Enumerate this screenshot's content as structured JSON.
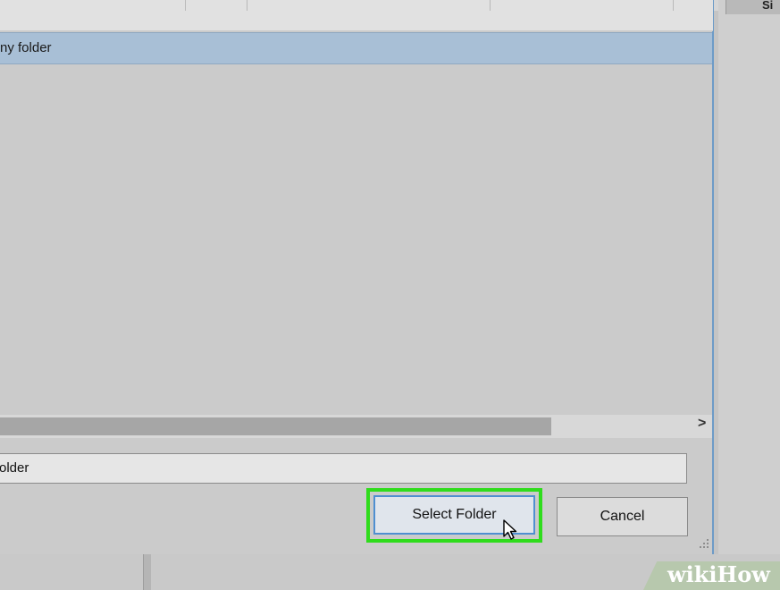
{
  "dialog": {
    "list": {
      "selected_item": "ny folder"
    },
    "scrollbar": {
      "right_arrow": ">"
    },
    "folder_field": {
      "value": "older"
    },
    "buttons": {
      "select_folder": "Select Folder",
      "cancel": "Cancel"
    }
  },
  "background_window": {
    "column_header": "Si"
  },
  "watermark": {
    "part1": "wiki",
    "part2": "How"
  },
  "colors": {
    "selection": "#a8bfd6",
    "highlight_border": "#2fdc1c",
    "default_button_border": "#4f8fd0"
  }
}
